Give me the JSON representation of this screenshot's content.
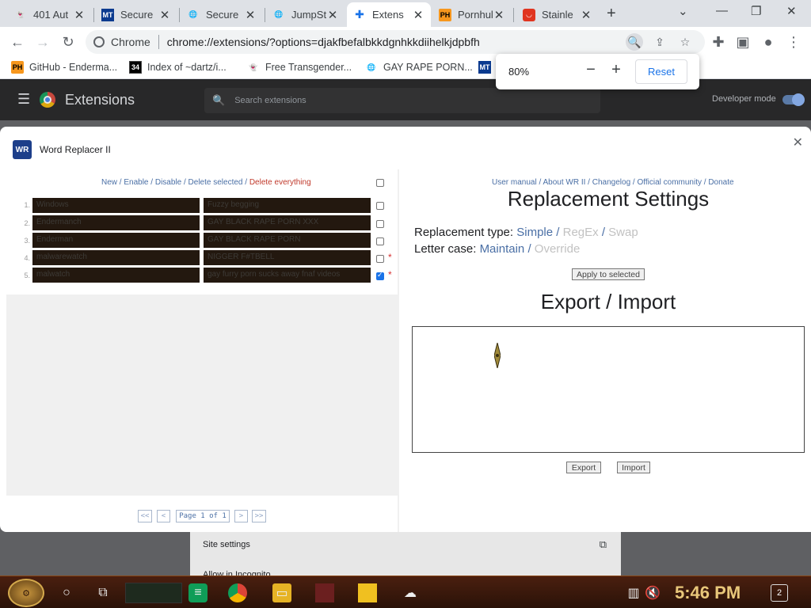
{
  "tabs": [
    {
      "title": "401 Aut",
      "icon": "ghost-icon"
    },
    {
      "title": "Secure",
      "icon": "mft-icon"
    },
    {
      "title": "Secure",
      "icon": "globe-icon"
    },
    {
      "title": "JumpSt",
      "icon": "globe-icon"
    },
    {
      "title": "Extens",
      "icon": "puzzle-icon"
    },
    {
      "title": "Pornhul",
      "icon": "ph-icon"
    },
    {
      "title": "Stainle",
      "icon": "red-square-icon"
    }
  ],
  "toolbar": {
    "chrome_label": "Chrome",
    "url": "chrome://extensions/?options=djakfbefalbkkdgnhkkdiihelkjdpbfh"
  },
  "bookmarks": [
    {
      "label": "GitHub - Enderma...",
      "icon": "ph-icon"
    },
    {
      "label": "Index of ~dartz/i...",
      "icon": "badge-icon"
    },
    {
      "label": "Free Transgender...",
      "icon": "ghost-icon"
    },
    {
      "label": "GAY RAPE PORN...",
      "icon": "globe-icon"
    }
  ],
  "zoom": {
    "level": "80%",
    "reset_label": "Reset"
  },
  "extensions_page": {
    "title": "Extensions",
    "search_placeholder": "Search extensions",
    "developer_mode": "Developer mode",
    "site_settings": "Site settings",
    "allow_incognito": "Allow in Incognito"
  },
  "dialog": {
    "title": "Word Replacer II",
    "logo_text": "WR",
    "commands": {
      "new": "New",
      "enable": "Enable",
      "disable": "Disable",
      "delete_selected": "Delete selected",
      "delete_everything": "Delete everything"
    },
    "rows": [
      {
        "num": "1.",
        "find": "Windows",
        "replace": "Fuzzy begging",
        "checked": false,
        "starred": false
      },
      {
        "num": "2.",
        "find": "Endermanch",
        "replace": "GAY BLACK RAPE PORN XXX",
        "checked": false,
        "starred": false
      },
      {
        "num": "3.",
        "find": "Enderman",
        "replace": "GAY BLACK RAPE PORN",
        "checked": false,
        "starred": false
      },
      {
        "num": "4.",
        "find": "malwarewatch",
        "replace": "NIGGER F#TBELL",
        "checked": false,
        "starred": true
      },
      {
        "num": "5.",
        "find": "malwatch",
        "replace": "gay furry porn sucks away fnaf videos",
        "checked": true,
        "starred": true
      }
    ],
    "pager": {
      "first": "<<",
      "prev": "<",
      "page_text": "Page 1 of 1",
      "next": ">",
      "last": ">>"
    },
    "right_links": {
      "manual": "User manual",
      "about": "About WR II",
      "changelog": "Changelog",
      "community": "Official community",
      "donate": "Donate"
    },
    "settings_heading": "Replacement Settings",
    "replacement_type": {
      "label": "Replacement type:",
      "simple": "Simple",
      "regex": "RegEx",
      "swap": "Swap"
    },
    "letter_case": {
      "label": "Letter case:",
      "maintain": "Maintain",
      "override": "Override"
    },
    "apply_label": "Apply to selected",
    "export_heading": "Export / Import",
    "export_label": "Export",
    "import_label": "Import"
  },
  "taskbar": {
    "time": "5:46 PM",
    "notifications": "2"
  },
  "colors": {
    "link": "#4a6fa5",
    "danger": "#c0392b",
    "row_bg": "#23180f",
    "chrome_blue": "#1a73e8"
  }
}
